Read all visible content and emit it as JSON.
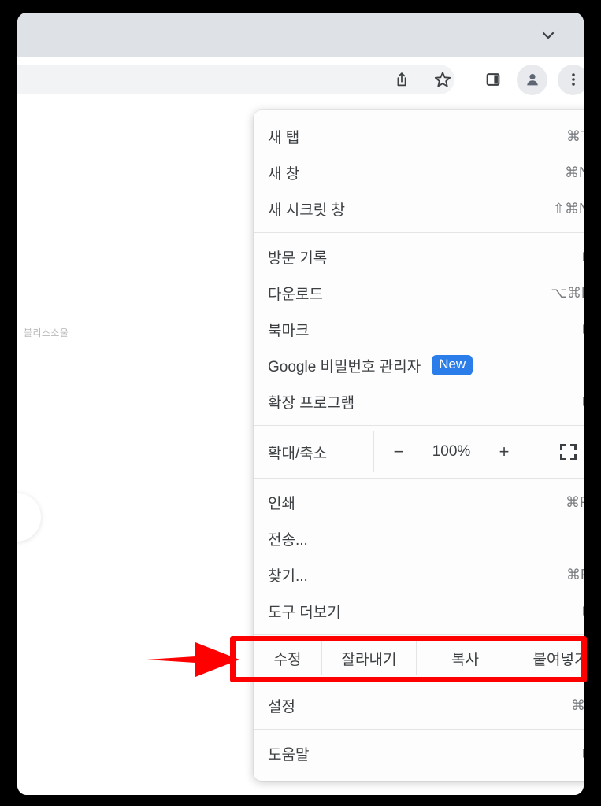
{
  "window": {
    "tabstrip": {
      "chevron_icon": "chevron-down-icon"
    },
    "toolbar": {
      "icons": [
        {
          "name": "share-icon",
          "label": "Share"
        },
        {
          "name": "star-icon",
          "label": "Bookmark"
        },
        {
          "name": "side-panel-icon",
          "label": "Side panel"
        },
        {
          "name": "profile-avatar-icon",
          "label": "Profile"
        },
        {
          "name": "three-dot-menu-icon",
          "label": "Customize and control Google Chrome"
        }
      ]
    }
  },
  "page": {
    "text": "블리스소울"
  },
  "menu": {
    "groups": [
      {
        "items": [
          {
            "label": "새 탭",
            "accel": "⌘T",
            "arrow": false
          },
          {
            "label": "새 창",
            "accel": "⌘N",
            "arrow": false
          },
          {
            "label": "새 시크릿 창",
            "accel": "⇧⌘N",
            "arrow": false
          }
        ]
      },
      {
        "items": [
          {
            "label": "방문 기록",
            "accel": "",
            "arrow": true
          },
          {
            "label": "다운로드",
            "accel": "⌥⌘L",
            "arrow": false
          },
          {
            "label": "북마크",
            "accel": "",
            "arrow": true
          },
          {
            "label": "Google 비밀번호 관리자",
            "accel": "",
            "arrow": false,
            "badge": "New"
          },
          {
            "label": "확장 프로그램",
            "accel": "",
            "arrow": true
          }
        ]
      }
    ],
    "zoom_row": {
      "label": "확대/축소",
      "minus": "−",
      "value": "100%",
      "plus": "+",
      "fullscreen_icon": "fullscreen-icon"
    },
    "actions": [
      {
        "label": "인쇄",
        "accel": "⌘P",
        "arrow": false
      },
      {
        "label": "전송...",
        "accel": "",
        "arrow": false
      },
      {
        "label": "찾기...",
        "accel": "⌘F",
        "arrow": false
      },
      {
        "label": "도구 더보기",
        "accel": "",
        "arrow": true
      }
    ],
    "edit_row": [
      {
        "label": "수정"
      },
      {
        "label": "잘라내기"
      },
      {
        "label": "복사"
      },
      {
        "label": "붙여넣기"
      }
    ],
    "settings": {
      "label": "설정",
      "accel": "⌘,"
    },
    "help": {
      "label": "도움말",
      "accel": "",
      "arrow": true
    }
  },
  "annotation": {
    "highlight_color": "#ff0000",
    "arrow_color": "#ff0000",
    "target": "설정"
  },
  "colors": {
    "badge_new_bg": "#2b7de9",
    "tabstrip_bg": "#dee1e6",
    "menu_bg": "#fdfdfd",
    "menu_text": "#3c4043",
    "accel_text": "#7a7d80"
  }
}
